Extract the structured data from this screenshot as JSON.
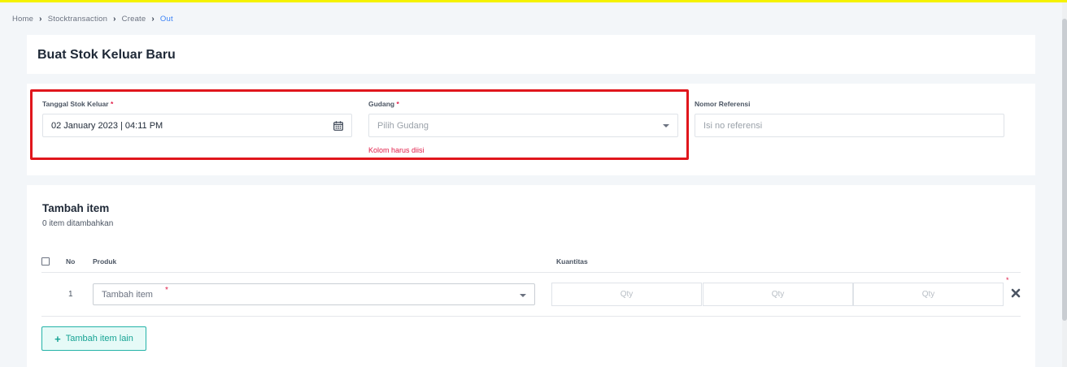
{
  "breadcrumb": {
    "items": [
      "Home",
      "Stocktransaction",
      "Create",
      "Out"
    ]
  },
  "page": {
    "title": "Buat Stok Keluar Baru"
  },
  "form": {
    "date": {
      "label": "Tanggal Stok Keluar",
      "required_mark": "*",
      "value": "02 January 2023 | 04:11 PM",
      "icon": "calendar-icon"
    },
    "warehouse": {
      "label": "Gudang",
      "required_mark": "*",
      "placeholder": "Pilih Gudang",
      "error": "Kolom harus diisi",
      "icon": "chevron-down-icon"
    },
    "reference": {
      "label": "Nomor Referensi",
      "placeholder": "Isi no referensi"
    }
  },
  "items": {
    "title": "Tambah item",
    "subtitle": "0 item ditambahkan",
    "columns": {
      "no": "No",
      "product": "Produk",
      "quantity": "Kuantitas"
    },
    "rows": [
      {
        "no": "1",
        "product_placeholder": "Tambah item",
        "required_mark": "*",
        "qty_placeholders": [
          "Qty",
          "Qty",
          "Qty"
        ],
        "qty_required_mark": "*"
      }
    ],
    "add_button": {
      "icon": "plus-icon",
      "label": "Tambah item lain"
    },
    "remove_icon": "close-icon"
  },
  "colors": {
    "accent": "#16a394",
    "error": "#e11d48",
    "highlight": "#e0161c",
    "link": "#3b82f6"
  }
}
